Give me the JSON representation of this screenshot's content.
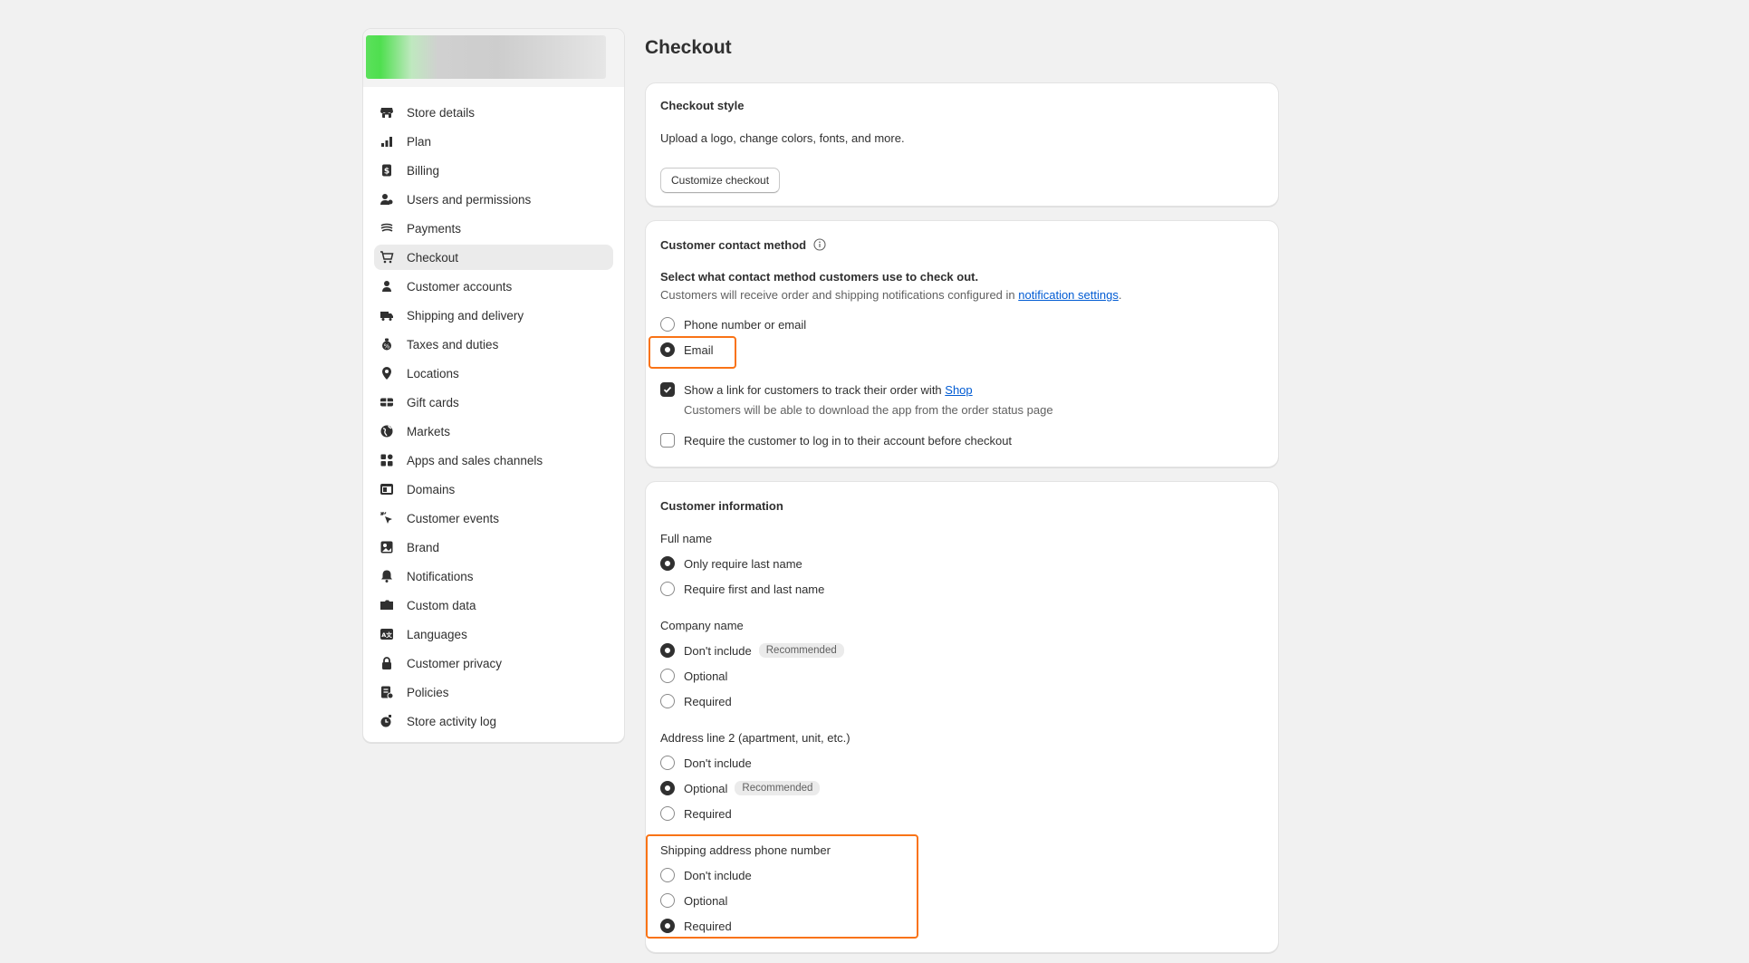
{
  "sidebar": {
    "items": [
      {
        "label": "Store details",
        "icon": "store-icon"
      },
      {
        "label": "Plan",
        "icon": "plan-icon"
      },
      {
        "label": "Billing",
        "icon": "billing-icon"
      },
      {
        "label": "Users and permissions",
        "icon": "users-icon"
      },
      {
        "label": "Payments",
        "icon": "payments-icon"
      },
      {
        "label": "Checkout",
        "icon": "cart-icon",
        "active": true
      },
      {
        "label": "Customer accounts",
        "icon": "person-icon"
      },
      {
        "label": "Shipping and delivery",
        "icon": "truck-icon"
      },
      {
        "label": "Taxes and duties",
        "icon": "tax-icon"
      },
      {
        "label": "Locations",
        "icon": "location-icon"
      },
      {
        "label": "Gift cards",
        "icon": "gift-card-icon"
      },
      {
        "label": "Markets",
        "icon": "globe-icon"
      },
      {
        "label": "Apps and sales channels",
        "icon": "apps-icon"
      },
      {
        "label": "Domains",
        "icon": "domain-icon"
      },
      {
        "label": "Customer events",
        "icon": "cursor-icon"
      },
      {
        "label": "Brand",
        "icon": "brand-icon"
      },
      {
        "label": "Notifications",
        "icon": "bell-icon"
      },
      {
        "label": "Custom data",
        "icon": "folder-icon"
      },
      {
        "label": "Languages",
        "icon": "language-icon"
      },
      {
        "label": "Customer privacy",
        "icon": "lock-icon"
      },
      {
        "label": "Policies",
        "icon": "policy-icon"
      },
      {
        "label": "Store activity log",
        "icon": "activity-icon"
      }
    ]
  },
  "page": {
    "title": "Checkout"
  },
  "checkout_style": {
    "title": "Checkout style",
    "description": "Upload a logo, change colors, fonts, and more.",
    "button": "Customize checkout"
  },
  "contact_method": {
    "title": "Customer contact method",
    "question": "Select what contact method customers use to check out.",
    "note_prefix": "Customers will receive order and shipping notifications configured in ",
    "note_link": "notification settings",
    "note_suffix": ".",
    "options": [
      "Phone number or email",
      "Email"
    ],
    "selected": "Email",
    "track_link_prefix": "Show a link for customers to track their order with ",
    "track_link_link": "Shop",
    "track_link_checked": true,
    "track_link_help": "Customers will be able to download the app from the order status page",
    "require_login": "Require the customer to log in to their account before checkout",
    "require_login_checked": false
  },
  "customer_info": {
    "title": "Customer information",
    "full_name": {
      "label": "Full name",
      "options": [
        "Only require last name",
        "Require first and last name"
      ],
      "selected": "Only require last name"
    },
    "company_name": {
      "label": "Company name",
      "options": [
        "Don't include",
        "Optional",
        "Required"
      ],
      "selected": "Don't include",
      "badge": "Recommended"
    },
    "address2": {
      "label": "Address line 2 (apartment, unit, etc.)",
      "options": [
        "Don't include",
        "Optional",
        "Required"
      ],
      "selected": "Optional",
      "badge": "Recommended"
    },
    "shipping_phone": {
      "label": "Shipping address phone number",
      "options": [
        "Don't include",
        "Optional",
        "Required"
      ],
      "selected": "Required"
    }
  },
  "colors": {
    "highlight": "#f97316",
    "link": "#005bd3",
    "active_nav": "#ebebeb"
  }
}
